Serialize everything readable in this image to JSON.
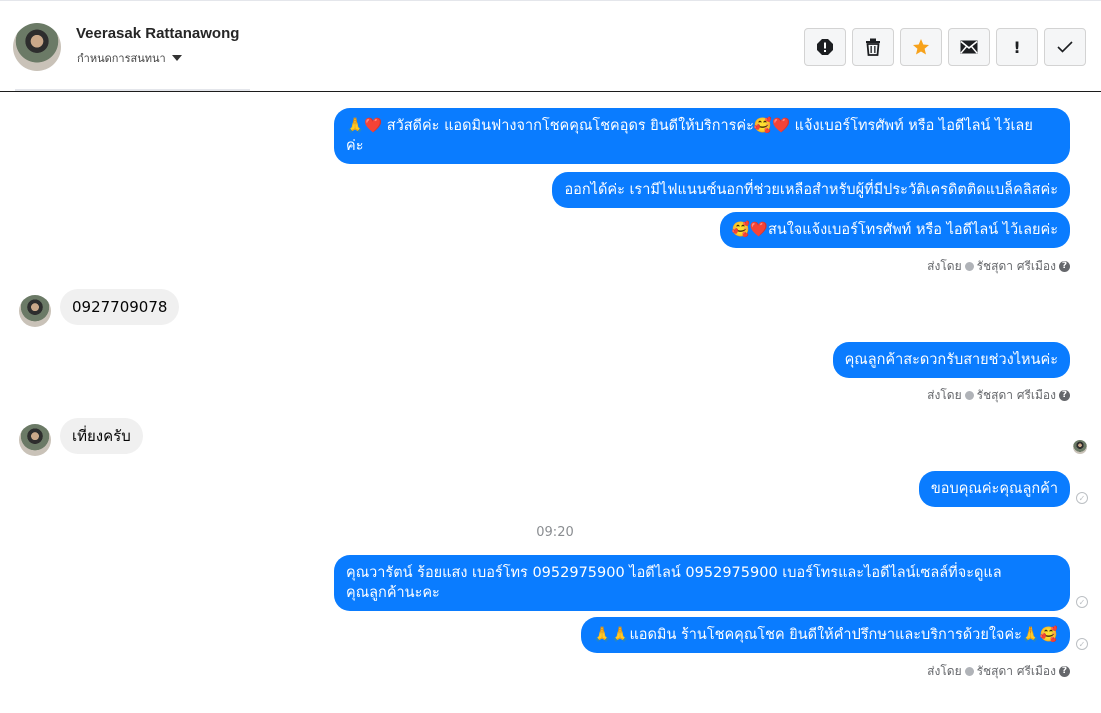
{
  "header": {
    "contact_name": "Veerasak Rattanawong",
    "contact_sub": "กำหนดการสนทนา",
    "toolbar": [
      {
        "name": "spam-icon",
        "glyph": "!"
      },
      {
        "name": "trash-icon",
        "glyph": ""
      },
      {
        "name": "star-icon",
        "glyph": "★"
      },
      {
        "name": "mail-icon",
        "glyph": ""
      },
      {
        "name": "important-icon",
        "glyph": "!"
      },
      {
        "name": "done-icon",
        "glyph": "✓"
      }
    ]
  },
  "messages": {
    "out1_line1": "🙏❤️ สวัสดีค่ะ แอดมินฟางจากโชคคุณโชคอุดร ยินดีให้บริการค่ะ🥰❤️ แจ้งเบอร์โทรศัพท์ หรือ ไอดีไลน์  ไว้เลย",
    "out1_line2": "ค่ะ",
    "out2": "ออกได้ค่ะ เรามีไฟแนนซ์นอกที่ช่วยเหลือสำหรับผู้ที่มีประวัติเครดิตติดแบล็คลิสค่ะ",
    "out3": "🥰❤️สนใจแจ้งเบอร์โทรศัพท์ หรือ ไอดีไลน์  ไว้เลยค่ะ",
    "in1": "0927709078",
    "out4": "คุณลูกค้าสะดวกรับสายช่วงไหนค่ะ",
    "in2": "เที่ยงครับ",
    "out5": "ขอบคุณค่ะคุณลูกค้า",
    "timestamp": "09:20",
    "out6_line1": "คุณวารัตน์ ร้อยแสง        เบอร์โทร 0952975900  ไอดีไลน์ 0952975900   เบอร์โทรและไอดีไลน์เซลล์ที่จะดูแล",
    "out6_line2": "คุณลูกค้านะคะ",
    "out7": "🙏🙏แอดมิน ร้านโชคคุณโชค ยินดีให้คำปรึกษาและบริการด้วยใจค่ะ🙏🥰"
  },
  "sent_by": {
    "prefix": "ส่งโดย",
    "agent": "รัชสุดา ศรีเมือง",
    "help": "?"
  },
  "colors": {
    "outgoing_bubble": "#0a7cff",
    "incoming_bubble": "#f0f0f0",
    "star": "#f7a21b"
  }
}
